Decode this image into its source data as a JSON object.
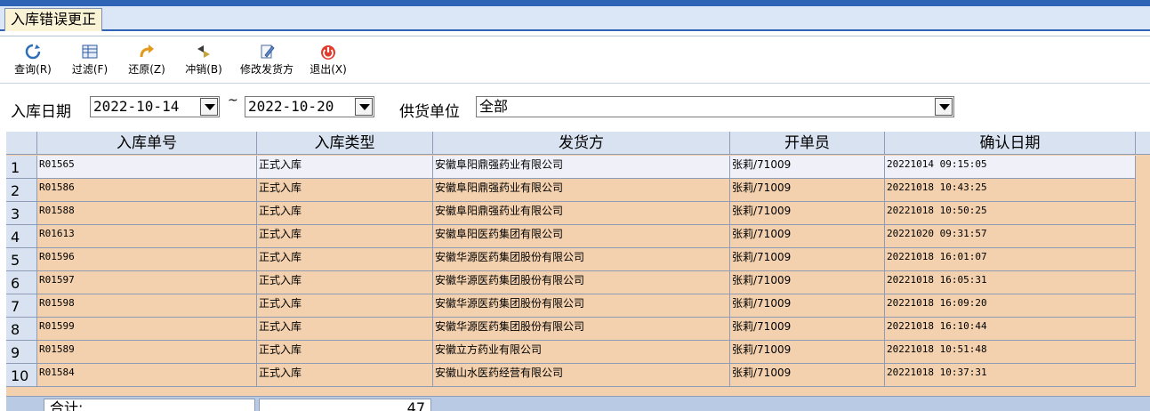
{
  "tab": {
    "label": "入库错误更正"
  },
  "toolbar": {
    "query": "查询(R)",
    "filter": "过滤(F)",
    "restore": "还原(Z)",
    "reverse": "冲销(B)",
    "edit_shipper": "修改发货方",
    "exit": "退出(X)"
  },
  "filter": {
    "date_label": "入库日期",
    "date_from": "2022-10-14",
    "tilde": "~",
    "date_to": "2022-10-20",
    "supplier_label": "供货单位",
    "supplier_value": "全部"
  },
  "grid": {
    "columns": [
      "入库单号",
      "入库类型",
      "发货方",
      "开单员",
      "确认日期"
    ],
    "rows": [
      {
        "idx": "1",
        "no": "R01565",
        "type": "正式入库",
        "shipper": "安徽阜阳鼎强药业有限公司",
        "clerk": "张莉/71009",
        "date": "20221014 09:15:05"
      },
      {
        "idx": "2",
        "no": "R01586",
        "type": "正式入库",
        "shipper": "安徽阜阳鼎强药业有限公司",
        "clerk": "张莉/71009",
        "date": "20221018 10:43:25"
      },
      {
        "idx": "3",
        "no": "R01588",
        "type": "正式入库",
        "shipper": "安徽阜阳鼎强药业有限公司",
        "clerk": "张莉/71009",
        "date": "20221018 10:50:25"
      },
      {
        "idx": "4",
        "no": "R01613",
        "type": "正式入库",
        "shipper": "安徽阜阳医药集团有限公司",
        "clerk": "张莉/71009",
        "date": "20221020 09:31:57"
      },
      {
        "idx": "5",
        "no": "R01596",
        "type": "正式入库",
        "shipper": "安徽华源医药集团股份有限公司",
        "clerk": "张莉/71009",
        "date": "20221018 16:01:07"
      },
      {
        "idx": "6",
        "no": "R01597",
        "type": "正式入库",
        "shipper": "安徽华源医药集团股份有限公司",
        "clerk": "张莉/71009",
        "date": "20221018 16:05:31"
      },
      {
        "idx": "7",
        "no": "R01598",
        "type": "正式入库",
        "shipper": "安徽华源医药集团股份有限公司",
        "clerk": "张莉/71009",
        "date": "20221018 16:09:20"
      },
      {
        "idx": "8",
        "no": "R01599",
        "type": "正式入库",
        "shipper": "安徽华源医药集团股份有限公司",
        "clerk": "张莉/71009",
        "date": "20221018 16:10:44"
      },
      {
        "idx": "9",
        "no": "R01589",
        "type": "正式入库",
        "shipper": "安徽立方药业有限公司",
        "clerk": "张莉/71009",
        "date": "20221018 10:51:48"
      },
      {
        "idx": "10",
        "no": "R01584",
        "type": "正式入库",
        "shipper": "安徽山水医药经营有限公司",
        "clerk": "张莉/71009",
        "date": "20221018 10:37:31"
      }
    ]
  },
  "footer": {
    "total_label": "合计:",
    "total_value": "47"
  },
  "colors": {
    "accent": "#2f63b5",
    "row_fill": "#f3d1ae",
    "header_fill": "#d8e2f0"
  }
}
